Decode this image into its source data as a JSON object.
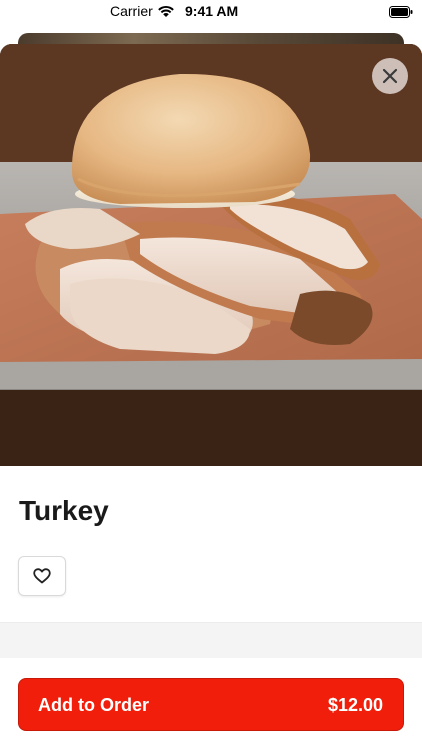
{
  "status_bar": {
    "carrier": "Carrier",
    "time": "9:41 AM",
    "icons": [
      "wifi-icon",
      "battery-icon"
    ]
  },
  "item": {
    "image": "photo-turkey-sandwich",
    "title": "Turkey",
    "favorite_icon": "heart-icon",
    "close_icon": "close-icon"
  },
  "order_button": {
    "label": "Add to Order",
    "price": "$12.00"
  },
  "colors": {
    "accent": "#f01e0a",
    "close_bg": "#e1d7d2",
    "title": "#1a1a1a"
  }
}
